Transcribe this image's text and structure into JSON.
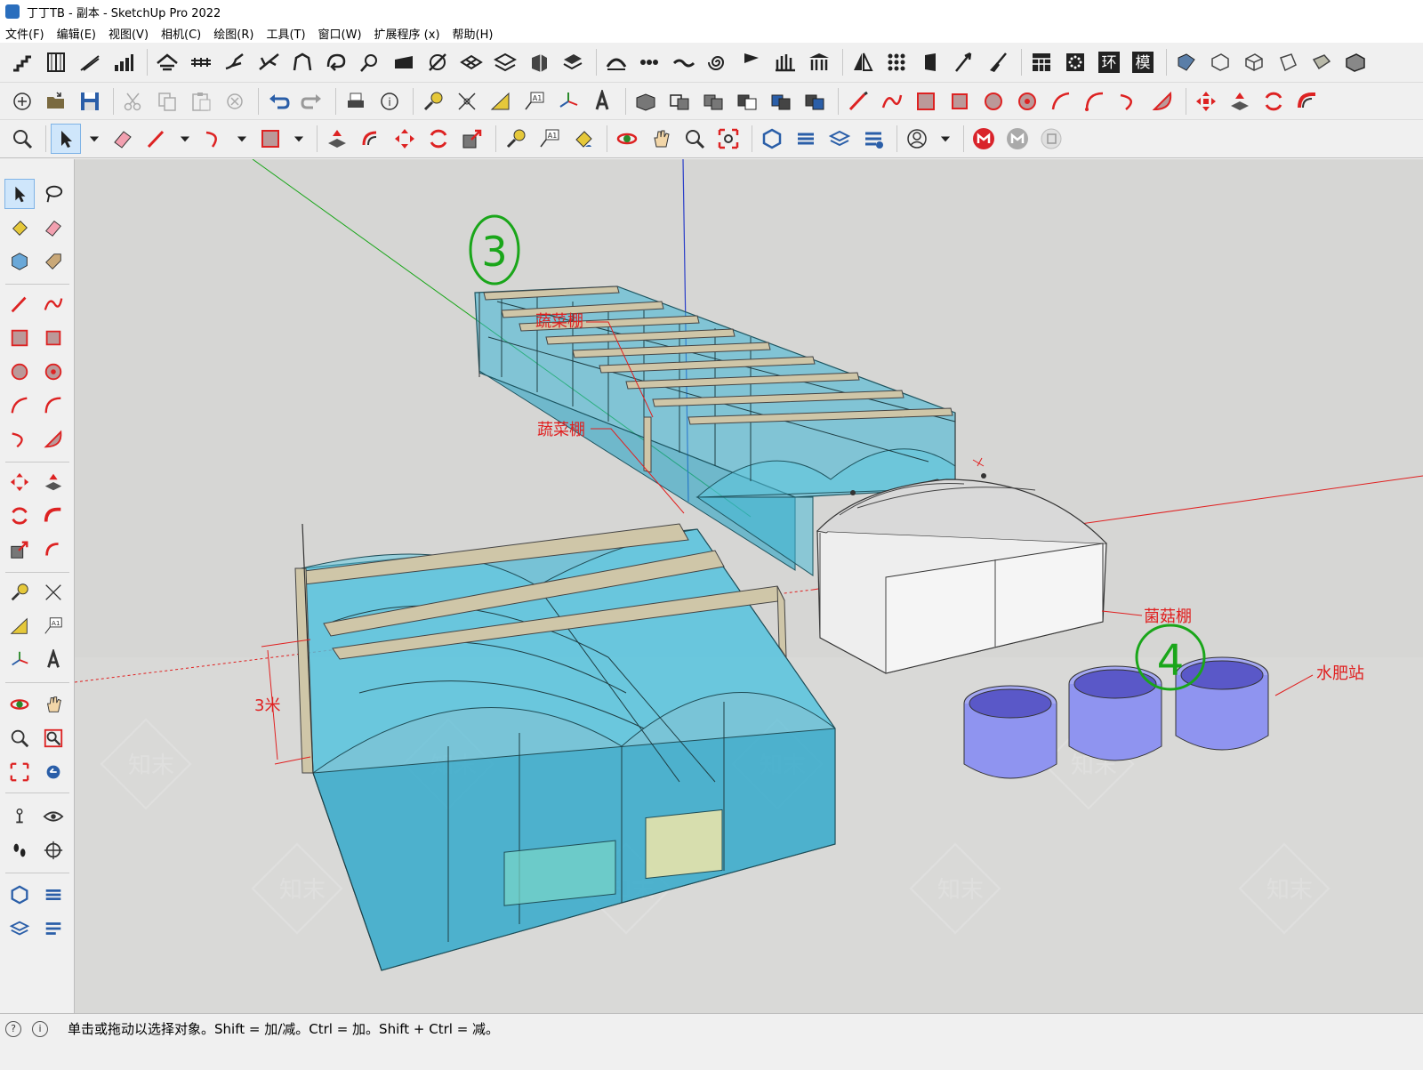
{
  "window": {
    "title": "丁丁TB - 副本 - SketchUp Pro 2022"
  },
  "menubar": {
    "items": [
      "文件(F)",
      "编辑(E)",
      "视图(V)",
      "相机(C)",
      "绘图(R)",
      "工具(T)",
      "窗口(W)",
      "扩展程序 (x)",
      "帮助(H)"
    ]
  },
  "toolbar_top": {
    "special_labels": [
      "环",
      "模"
    ]
  },
  "viewport": {
    "labels": {
      "greenhouse_number_3": "3",
      "greenhouse_number_4": "4",
      "vegetable_shed_1": "蔬菜棚",
      "vegetable_shed_2": "蔬菜棚",
      "mushroom_shed": "菌菇棚",
      "fertigation_station": "水肥站",
      "dimension_height": "3米"
    },
    "watermark": "知末",
    "colors": {
      "glass": "#3db7d6",
      "beam": "#cfc6a8",
      "mushroom": "#eeeeee",
      "tank": "#8f94f0",
      "label_red": "#e02020",
      "marker_green": "#1aa61a"
    }
  },
  "statusbar": {
    "text": "单击或拖动以选择对象。Shift = 加/减。Ctrl = 加。Shift + Ctrl = 减。"
  }
}
